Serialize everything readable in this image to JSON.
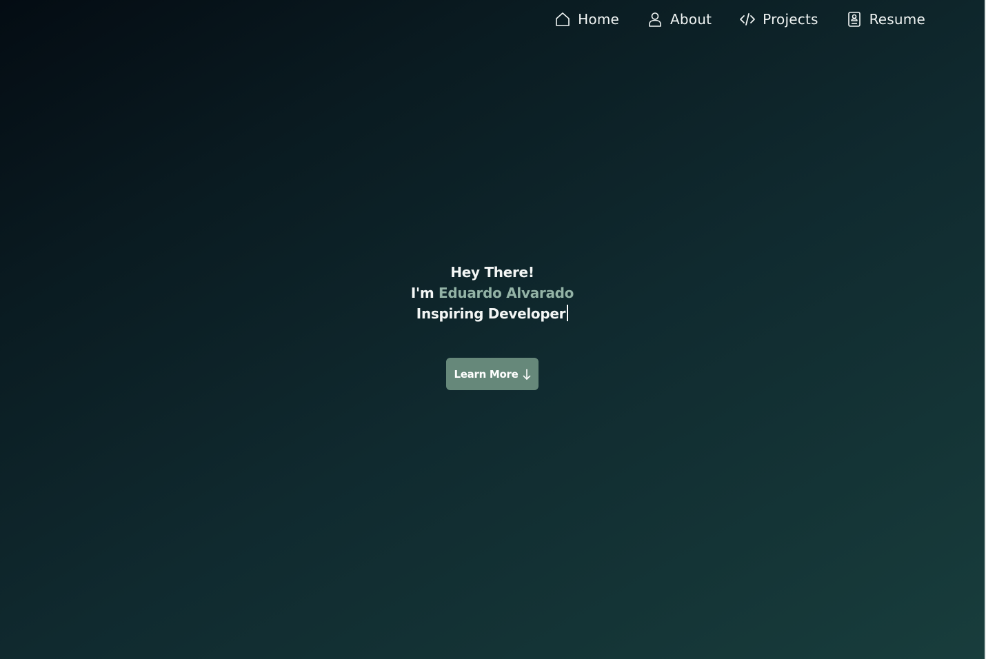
{
  "nav": {
    "items": [
      {
        "label": "Home",
        "icon": "home-icon"
      },
      {
        "label": "About",
        "icon": "user-icon"
      },
      {
        "label": "Projects",
        "icon": "code-icon"
      },
      {
        "label": "Resume",
        "icon": "resume-icon"
      }
    ]
  },
  "hero": {
    "greeting": "Hey There!",
    "intro_prefix": "I'm",
    "name": "Eduardo Alvarado",
    "role": "Inspiring Developer"
  },
  "cta": {
    "label": "Learn More",
    "icon": "arrow-down-icon"
  },
  "colors": {
    "accent": "#93b3a6",
    "button": "#66887a",
    "background_start": "#040c13",
    "background_end": "#183d3c"
  }
}
